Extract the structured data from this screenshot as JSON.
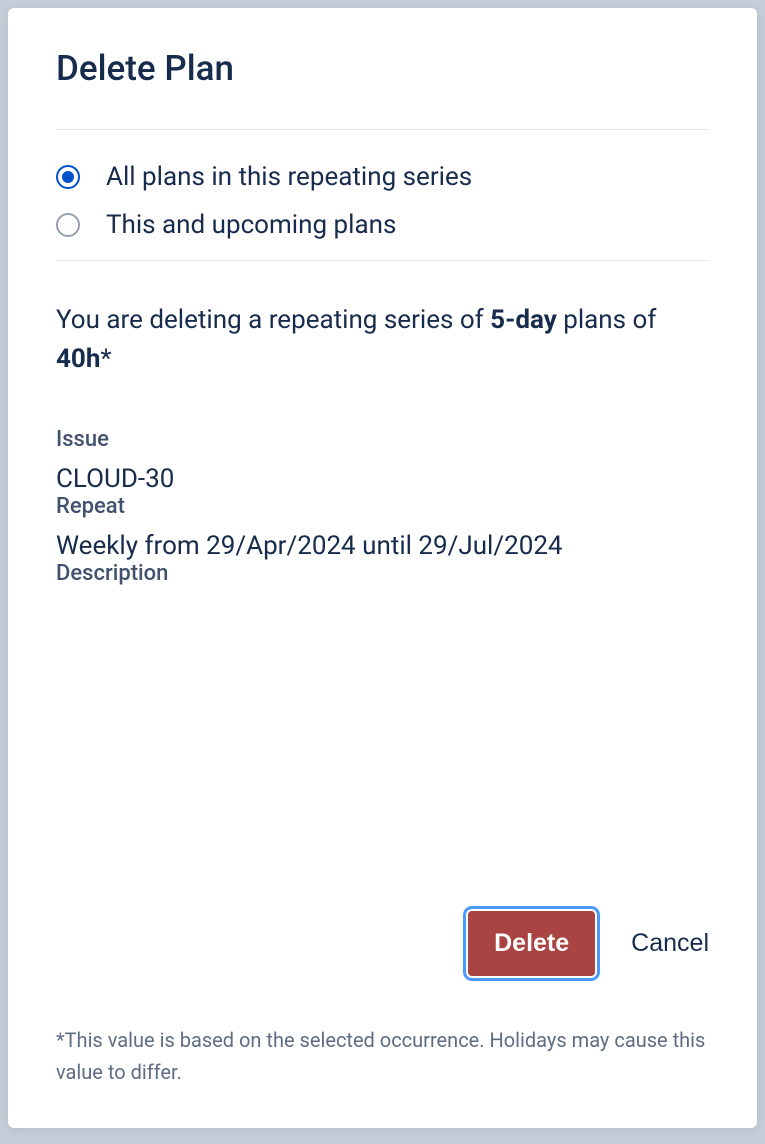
{
  "dialog": {
    "title": "Delete Plan"
  },
  "radios": {
    "option1": "All plans in this repeating series",
    "option2": "This and upcoming plans",
    "selected": 1
  },
  "summary": {
    "prefix": "You are deleting a repeating series of ",
    "duration": "5-day",
    "middle": " plans of ",
    "hours": "40h",
    "suffix": "*"
  },
  "fields": {
    "issue_label": "Issue",
    "issue_value": "CLOUD-30",
    "repeat_label": "Repeat",
    "repeat_value": "Weekly from 29/Apr/2024 until 29/Jul/2024",
    "description_label": "Description",
    "description_value": ""
  },
  "buttons": {
    "delete": "Delete",
    "cancel": "Cancel"
  },
  "footnote": "*This value is based on the selected occurrence. Holidays may cause this value to differ."
}
